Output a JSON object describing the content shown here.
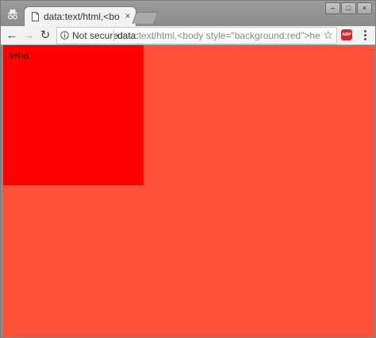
{
  "tab": {
    "title": "data:text/html,<bo",
    "close_glyph": "×"
  },
  "window_controls": {
    "minimize": "–",
    "maximize": "□",
    "close": "×"
  },
  "toolbar": {
    "back_glyph": "←",
    "forward_glyph": "→",
    "reload_glyph": "↻",
    "security_label": "Not secure",
    "url_scheme": "data:",
    "url_rest": "text/html,<body style=\"background:red\">hello",
    "bookmark_glyph": "☆",
    "extension_label": "ABP"
  },
  "page": {
    "content_text": "hello",
    "body_color": "#ff0000",
    "viewport_color": "#ff5038"
  },
  "icons": {
    "profile": "incognito-icon",
    "favicon": "page-icon",
    "info": "info-icon",
    "menu": "kebab-menu-icon"
  }
}
